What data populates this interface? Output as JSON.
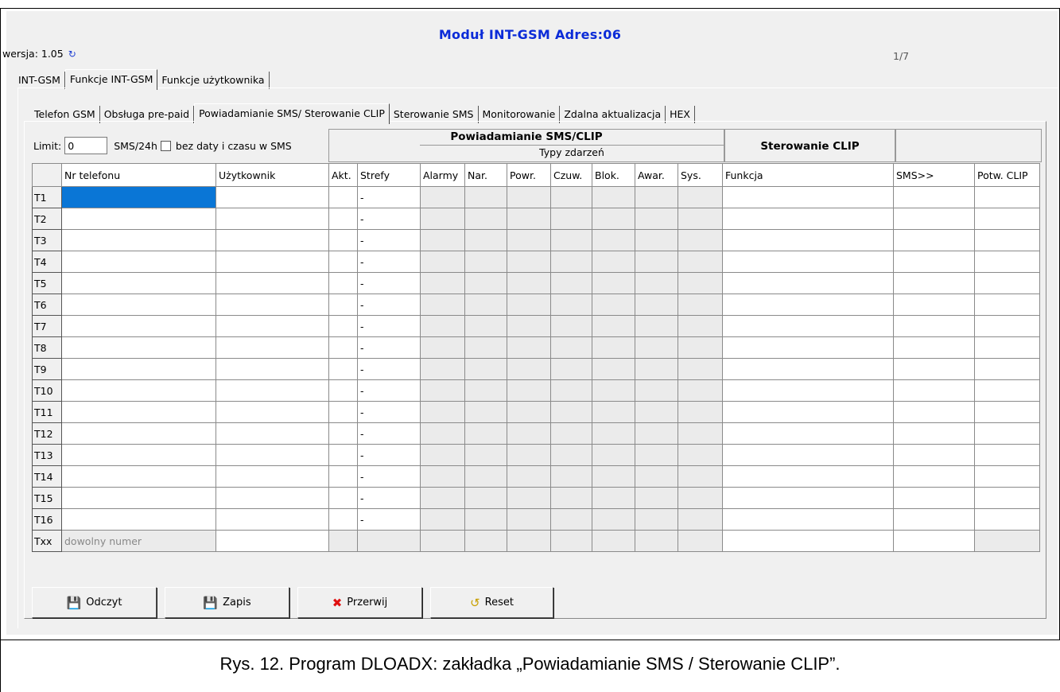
{
  "window": {
    "title": "Moduł INT-GSM Adres:06",
    "version": "wersja: 1.05",
    "page": "1/7"
  },
  "main_tabs": [
    "INT-GSM",
    "Funkcje INT-GSM",
    "Funkcje użytkownika"
  ],
  "sub_tabs": [
    "Telefon GSM",
    "Obsługa pre-paid",
    "Powiadamianie SMS/ Sterowanie CLIP",
    "Sterowanie SMS",
    "Monitorowanie",
    "Zdalna aktualizacja",
    "HEX"
  ],
  "limit": {
    "label": "Limit:",
    "value": "0",
    "unit": "SMS/24h",
    "checkbox_label": "bez daty i czasu w SMS",
    "checked": false
  },
  "groups": {
    "sms_clip": "Powiadamianie SMS/CLIP",
    "event_types": "Typy zdarzeń",
    "clip_control": "Sterowanie CLIP"
  },
  "columns": [
    "Nr telefonu",
    "Użytkownik",
    "Akt.",
    "Strefy",
    "Alarmy",
    "Nar.",
    "Powr.",
    "Czuw.",
    "Blok.",
    "Awar.",
    "Sys.",
    "Funkcja",
    "SMS>>",
    "Potw. CLIP"
  ],
  "rows": [
    {
      "label": "T1",
      "strefy": "-"
    },
    {
      "label": "T2",
      "strefy": "-"
    },
    {
      "label": "T3",
      "strefy": "-"
    },
    {
      "label": "T4",
      "strefy": "-"
    },
    {
      "label": "T5",
      "strefy": "-"
    },
    {
      "label": "T6",
      "strefy": "-"
    },
    {
      "label": "T7",
      "strefy": "-"
    },
    {
      "label": "T8",
      "strefy": "-"
    },
    {
      "label": "T9",
      "strefy": "-"
    },
    {
      "label": "T10",
      "strefy": "-"
    },
    {
      "label": "T11",
      "strefy": "-"
    },
    {
      "label": "T12",
      "strefy": "-"
    },
    {
      "label": "T13",
      "strefy": "-"
    },
    {
      "label": "T14",
      "strefy": "-"
    },
    {
      "label": "T15",
      "strefy": "-"
    },
    {
      "label": "T16",
      "strefy": "-"
    }
  ],
  "any_number_row": {
    "label": "Txx",
    "placeholder": "dowolny numer"
  },
  "buttons": [
    {
      "label": "Odczyt",
      "icon": "read-icon"
    },
    {
      "label": "Zapis",
      "icon": "write-icon"
    },
    {
      "label": "Przerwij",
      "icon": "cancel-x-icon"
    },
    {
      "label": "Reset",
      "icon": "reset-icon"
    }
  ],
  "caption": "Rys. 12. Program DLOADX: zakładka „Powiadamianie SMS / Sterowanie CLIP”.",
  "colors": {
    "title": "#0b2bd8",
    "selection": "#0a76d6",
    "cancel_icon": "#e01010"
  }
}
